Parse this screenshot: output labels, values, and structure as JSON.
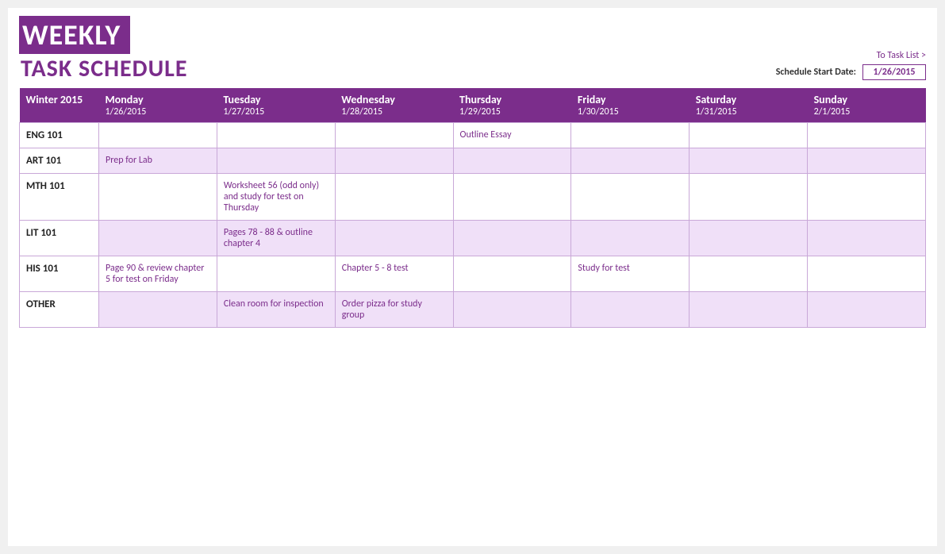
{
  "title": {
    "line1": "WEEKLY",
    "line2": "TASK SCHEDULE"
  },
  "to_task_link": "To Task List >",
  "start_date_label": "Schedule Start Date:",
  "start_date_value": "1/26/2015",
  "header": {
    "col0": {
      "day": "Winter 2015",
      "date": ""
    },
    "col1": {
      "day": "Monday",
      "date": "1/26/2015"
    },
    "col2": {
      "day": "Tuesday",
      "date": "1/27/2015"
    },
    "col3": {
      "day": "Wednesday",
      "date": "1/28/2015"
    },
    "col4": {
      "day": "Thursday",
      "date": "1/29/2015"
    },
    "col5": {
      "day": "Friday",
      "date": "1/30/2015"
    },
    "col6": {
      "day": "Saturday",
      "date": "1/31/2015"
    },
    "col7": {
      "day": "Sunday",
      "date": "2/1/2015"
    }
  },
  "rows": [
    {
      "label": "ENG 101",
      "style": "white",
      "cells": [
        "",
        "",
        "",
        "Outline Essay",
        "",
        "",
        ""
      ]
    },
    {
      "label": "ART 101",
      "style": "purple",
      "cells": [
        "Prep for Lab",
        "",
        "",
        "",
        "",
        "",
        ""
      ]
    },
    {
      "label": "MTH 101",
      "style": "white",
      "cells": [
        "",
        "Worksheet 56 (odd only) and study for test on Thursday",
        "",
        "",
        "",
        "",
        ""
      ]
    },
    {
      "label": "LIT 101",
      "style": "purple",
      "cells": [
        "",
        "Pages 78 - 88 & outline chapter 4",
        "",
        "",
        "",
        "",
        ""
      ]
    },
    {
      "label": "HIS 101",
      "style": "white",
      "cells": [
        "Page 90 & review chapter 5 for test on Friday",
        "",
        "Chapter 5 - 8 test",
        "",
        "Study for test",
        "",
        ""
      ]
    },
    {
      "label": "OTHER",
      "style": "purple",
      "cells": [
        "",
        "Clean room for inspection",
        "Order pizza for study group",
        "",
        "",
        "",
        ""
      ]
    }
  ]
}
